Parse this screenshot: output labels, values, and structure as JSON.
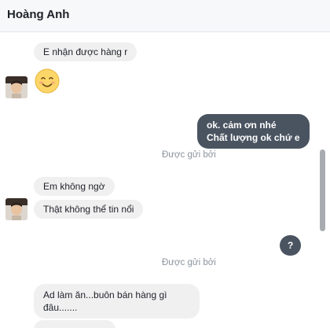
{
  "header": {
    "title": "Hoàng Anh"
  },
  "messages": [
    {
      "text": "E nhận được hàng r",
      "direction": "incoming"
    },
    {
      "emoji": "☺",
      "emoji_name": "smiling-face-emoji",
      "direction": "incoming"
    },
    {
      "line1": "ok. cảm ơn nhé",
      "line2": "Chất lượng ok chứ e",
      "direction": "outgoing"
    },
    {
      "status": "Được gửi bởi"
    },
    {
      "text": "Em không ngờ",
      "direction": "incoming"
    },
    {
      "text": "Thật không thể tin nổi",
      "direction": "incoming"
    },
    {
      "text": "?",
      "direction": "outgoing"
    },
    {
      "status": "Được gửi bởi"
    },
    {
      "line1": "Ad làm ăn...buôn bán hàng gì",
      "line2": "đâu.......",
      "direction": "incoming"
    }
  ],
  "colors": {
    "outgoing_bubble": "#4a5461",
    "incoming_bubble": "#f1f0f0",
    "header_bg": "#f7f8fa",
    "status_text": "#8d949e"
  }
}
